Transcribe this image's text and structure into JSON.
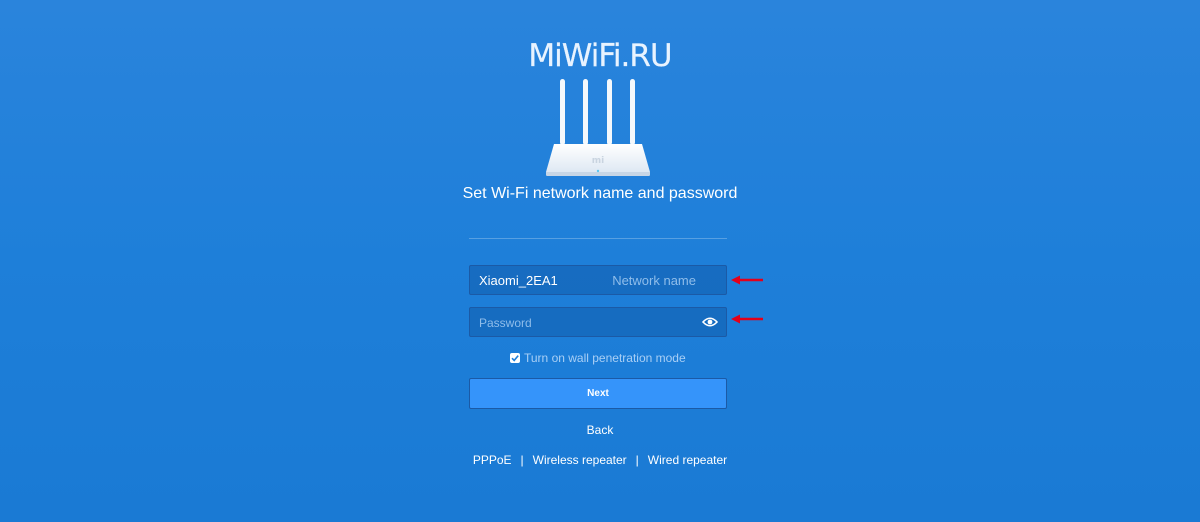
{
  "brand": {
    "text": "MiWiFi.RU"
  },
  "router_image": {
    "logo_text": "mi"
  },
  "setup": {
    "title": "Set Wi-Fi network name and password"
  },
  "network_name": {
    "value": "Xiaomi_2EA1",
    "hint": "Network name"
  },
  "password": {
    "placeholder": "Password",
    "value": ""
  },
  "wall_penetration": {
    "label": "Turn on wall penetration mode",
    "checked": true
  },
  "buttons": {
    "next_label": "Next",
    "back_label": "Back"
  },
  "modes": {
    "items": [
      "PPPoE",
      "Wireless repeater",
      "Wired repeater"
    ],
    "separator": "|"
  },
  "colors": {
    "background": "#1e7fd9",
    "primary_button": "#3594fa",
    "annotation_arrow": "#e3001b"
  }
}
